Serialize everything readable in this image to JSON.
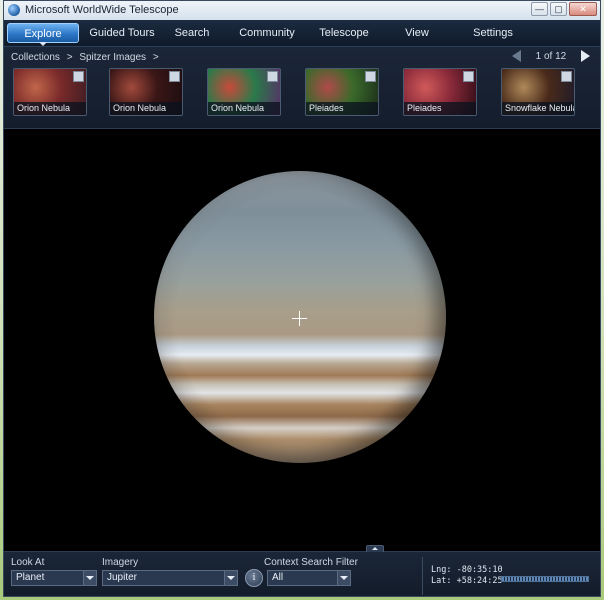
{
  "window": {
    "title": "Microsoft WorldWide Telescope",
    "buttons": {
      "minimize": "—",
      "maximize": "▢",
      "close": "✕"
    }
  },
  "menu": {
    "items": [
      {
        "label": "Explore",
        "active": true
      },
      {
        "label": "Guided Tours"
      },
      {
        "label": "Search"
      },
      {
        "label": "Community"
      },
      {
        "label": "Telescope"
      },
      {
        "label": "View"
      },
      {
        "label": "Settings"
      }
    ]
  },
  "explore": {
    "breadcrumb": [
      "Collections",
      ">",
      "Spitzer Images",
      ">"
    ],
    "pager": "1 of 12",
    "thumbnails": [
      {
        "label": "Orion Nebula",
        "colors": [
          "#7a2a2a",
          "#c0664a",
          "#3a1c22"
        ]
      },
      {
        "label": "Orion Nebula",
        "colors": [
          "#3a1616",
          "#a24a3c",
          "#1a0c10"
        ]
      },
      {
        "label": "Orion Nebula",
        "colors": [
          "#2a7a4a",
          "#c84a3a",
          "#5a2a6a"
        ]
      },
      {
        "label": "Pleiades",
        "colors": [
          "#3a6a2a",
          "#b04a4a",
          "#1a2a1a"
        ]
      },
      {
        "label": "Pleiades",
        "colors": [
          "#8a2a3a",
          "#d05a5a",
          "#2a0a14"
        ]
      },
      {
        "label": "Snowflake Nebula",
        "colors": [
          "#4a2a1a",
          "#b08a5a",
          "#1a1a2a"
        ]
      }
    ]
  },
  "viewer": {
    "object": "Jupiter"
  },
  "bottom": {
    "look_at_label": "Look At",
    "look_at_value": "Planet",
    "imagery_label": "Imagery",
    "imagery_value": "Jupiter",
    "context_filter_label": "Context Search Filter",
    "context_filter_value": "All",
    "info_icon": "i",
    "lng": "Lng:  -80:35:10",
    "lat": "Lat:  +58:24:25"
  },
  "colors": {
    "accent": "#2d78c8",
    "panel": "#1b2638",
    "viewer_bg": "#000000"
  }
}
